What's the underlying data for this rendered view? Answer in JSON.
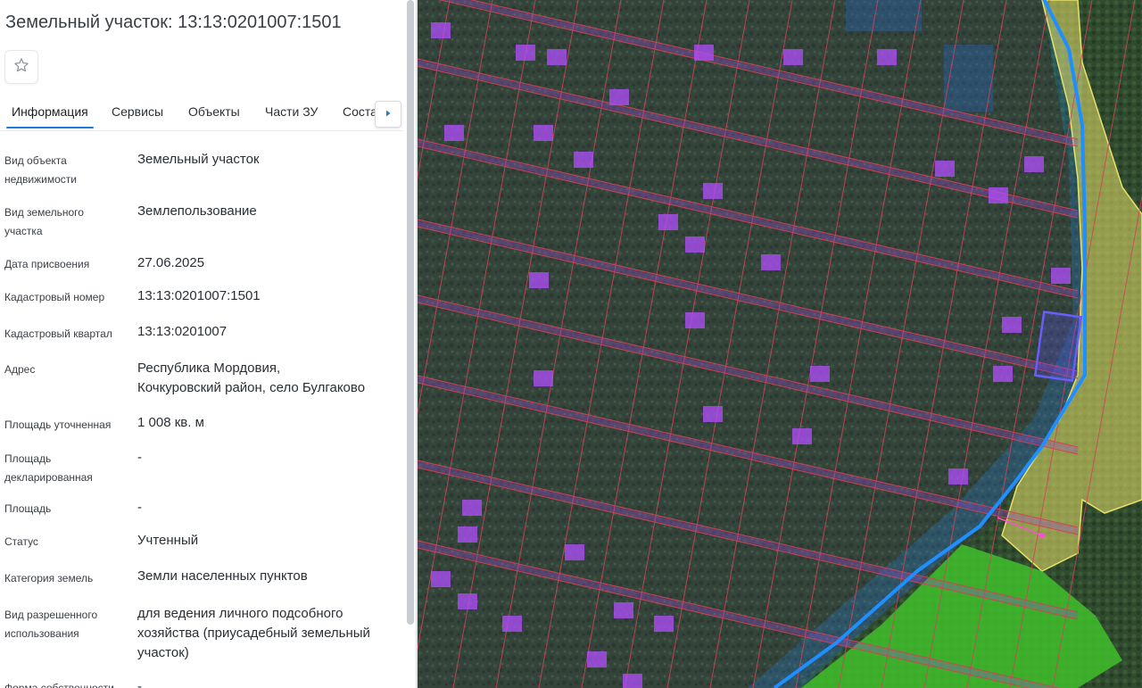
{
  "panel": {
    "title": "Земельный участок: 13:13:0201007:1501",
    "tabs": [
      {
        "label": "Информация"
      },
      {
        "label": "Сервисы"
      },
      {
        "label": "Объекты"
      },
      {
        "label": "Части ЗУ"
      },
      {
        "label": "Соста"
      }
    ],
    "rows": [
      {
        "label": "Вид объекта\nнедвижимости",
        "value": "Земельный участок"
      },
      {
        "label": "Вид земельного\nучастка",
        "value": "Землепользование"
      },
      {
        "label": "Дата присвоения",
        "value": "27.06.2025"
      },
      {
        "label": "Кадастровый номер",
        "value": "13:13:0201007:1501"
      },
      {
        "label": "Кадастровый квартал",
        "value": "13:13:0201007"
      },
      {
        "label": "Адрес",
        "value": "Республика Мордовия,\nКочкуровский район, село Булгаково"
      },
      {
        "label": "Площадь уточненная",
        "value": "1 008 кв. м"
      },
      {
        "label": "Площадь\nдекларированная",
        "value": "-"
      },
      {
        "label": "Площадь",
        "value": "-"
      },
      {
        "label": "Статус",
        "value": "Учтенный"
      },
      {
        "label": "Категория земель",
        "value": "Земли населенных пунктов"
      },
      {
        "label": "Вид разрешенного\nиспользования",
        "value": "для ведения личного подсобного\nхозяйства (приусадебный земельный\nучасток)"
      },
      {
        "label": "Форма собственности",
        "value": "-"
      }
    ]
  },
  "icons": {
    "favorite": "star-icon",
    "tabs_next": "chevron-right-icon"
  },
  "colors": {
    "accent": "#1e7bd6",
    "parcel_border": "#d0435a",
    "building": "#b34dff",
    "boundary": "#1f8fff",
    "zone_yellow": "#e8e06a",
    "forest_green": "#3fbf2a"
  }
}
